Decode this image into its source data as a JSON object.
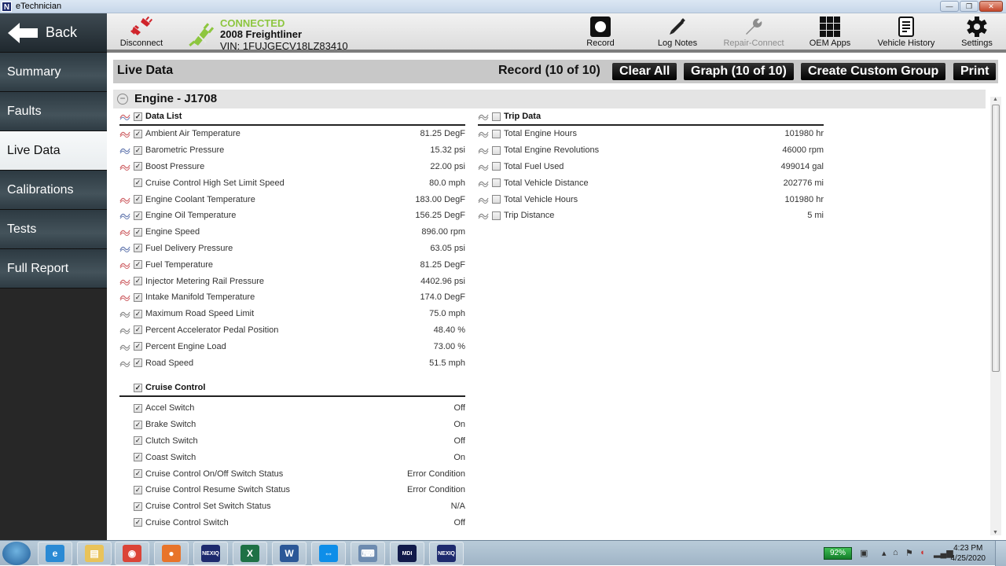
{
  "window": {
    "title": "eTechnician",
    "app_icon": "N",
    "controls": {
      "minimize": "—",
      "restore": "❐",
      "close": "✕"
    }
  },
  "toolbar": {
    "back_label": "Back",
    "disconnect_label": "Disconnect",
    "connection_status": "CONNECTED",
    "vehicle": "2008 Freightliner",
    "vin": "VIN: 1FUJGECV18LZ83410",
    "record_label": "Record",
    "log_notes_label": "Log Notes",
    "repair_connect_label": "Repair-Connect",
    "oem_apps_label": "OEM Apps",
    "vehicle_history_label": "Vehicle History",
    "settings_label": "Settings"
  },
  "sidebar": {
    "items": [
      {
        "label": "Summary",
        "active": false
      },
      {
        "label": "Faults",
        "active": false
      },
      {
        "label": "Live Data",
        "active": true
      },
      {
        "label": "Calibrations",
        "active": false
      },
      {
        "label": "Tests",
        "active": false
      },
      {
        "label": "Full Report",
        "active": false
      }
    ]
  },
  "live_data": {
    "title": "Live Data",
    "record_status": "Record (10 of 10)",
    "clear_all_label": "Clear All",
    "graph_label": "Graph (10 of 10)",
    "create_group_label": "Create Custom Group",
    "print_label": "Print",
    "section_name": "Engine - J1708",
    "collapse_glyph": "−",
    "data_list": {
      "title": "Data List",
      "checked": true,
      "rows": [
        {
          "label": "Ambient Air Temperature",
          "value": "81.25 DegF",
          "graph": "red",
          "checked": true
        },
        {
          "label": "Barometric Pressure",
          "value": "15.32 psi",
          "graph": "blue",
          "checked": true
        },
        {
          "label": "Boost Pressure",
          "value": "22.00 psi",
          "graph": "red",
          "checked": true
        },
        {
          "label": "Cruise Control High Set Limit Speed",
          "value": "80.0 mph",
          "graph": "",
          "checked": true
        },
        {
          "label": "Engine Coolant Temperature",
          "value": "183.00 DegF",
          "graph": "red",
          "checked": true
        },
        {
          "label": "Engine Oil Temperature",
          "value": "156.25 DegF",
          "graph": "blue",
          "checked": true
        },
        {
          "label": "Engine Speed",
          "value": "896.00 rpm",
          "graph": "red",
          "checked": true
        },
        {
          "label": "Fuel Delivery Pressure",
          "value": "63.05 psi",
          "graph": "blue",
          "checked": true
        },
        {
          "label": "Fuel Temperature",
          "value": "81.25 DegF",
          "graph": "red",
          "checked": true
        },
        {
          "label": "Injector Metering Rail Pressure",
          "value": "4402.96 psi",
          "graph": "red",
          "checked": true
        },
        {
          "label": "Intake Manifold Temperature",
          "value": "174.0 DegF",
          "graph": "red",
          "checked": true
        },
        {
          "label": "Maximum Road Speed Limit",
          "value": "75.0 mph",
          "graph": "gray",
          "checked": true
        },
        {
          "label": "Percent Accelerator Pedal Position",
          "value": "48.40 %",
          "graph": "gray",
          "checked": true
        },
        {
          "label": "Percent Engine Load",
          "value": "73.00 %",
          "graph": "gray",
          "checked": true
        },
        {
          "label": "Road Speed",
          "value": "51.5 mph",
          "graph": "gray",
          "checked": true
        }
      ]
    },
    "cruise_control": {
      "title": "Cruise Control",
      "checked": true,
      "rows": [
        {
          "label": "Accel Switch",
          "value": "Off",
          "checked": true
        },
        {
          "label": "Brake Switch",
          "value": "On",
          "checked": true
        },
        {
          "label": "Clutch Switch",
          "value": "Off",
          "checked": true
        },
        {
          "label": "Coast Switch",
          "value": "On",
          "checked": true
        },
        {
          "label": "Cruise Control On/Off Switch Status",
          "value": "Error Condition",
          "checked": true
        },
        {
          "label": "Cruise Control Resume Switch Status",
          "value": "Error Condition",
          "checked": true
        },
        {
          "label": "Cruise Control Set Switch Status",
          "value": "N/A",
          "checked": true
        },
        {
          "label": "Cruise Control Switch",
          "value": "Off",
          "checked": true
        }
      ]
    },
    "trip_data": {
      "title": "Trip Data",
      "checked": false,
      "rows": [
        {
          "label": "Total Engine Hours",
          "value": "101980 hr",
          "graph": "gray",
          "checked": false
        },
        {
          "label": "Total Engine Revolutions",
          "value": "46000 rpm",
          "graph": "gray",
          "checked": false
        },
        {
          "label": "Total Fuel Used",
          "value": "499014 gal",
          "graph": "gray",
          "checked": false
        },
        {
          "label": "Total Vehicle Distance",
          "value": "202776 mi",
          "graph": "gray",
          "checked": false
        },
        {
          "label": "Total Vehicle Hours",
          "value": "101980 hr",
          "graph": "gray",
          "checked": false
        },
        {
          "label": "Trip Distance",
          "value": "5 mi",
          "graph": "gray",
          "checked": false
        }
      ]
    }
  },
  "taskbar": {
    "apps": [
      {
        "name": "internet-explorer",
        "glyph": "e",
        "color": "#2a8ad4"
      },
      {
        "name": "file-explorer",
        "glyph": "▤",
        "color": "#e9c35a"
      },
      {
        "name": "chrome",
        "glyph": "◉",
        "color": "#db4437"
      },
      {
        "name": "firefox",
        "glyph": "●",
        "color": "#e8742a"
      },
      {
        "name": "nexiq",
        "glyph": "NEXIQ",
        "color": "#1d2a6e"
      },
      {
        "name": "excel",
        "glyph": "X",
        "color": "#1e7145"
      },
      {
        "name": "word",
        "glyph": "W",
        "color": "#2b5797"
      },
      {
        "name": "teamviewer",
        "glyph": "⇔",
        "color": "#0e8ee9"
      },
      {
        "name": "device-manager",
        "glyph": "⌨",
        "color": "#6d8bb0"
      },
      {
        "name": "mdi",
        "glyph": "MDI",
        "color": "#111a4a"
      },
      {
        "name": "nexiq-etechnician",
        "glyph": "NEXIQ",
        "color": "#1d2a6e"
      }
    ],
    "battery": "92%",
    "time": "4:23 PM",
    "date": "4/25/2020"
  },
  "colors": {
    "connected": "#8dc63f",
    "disconnect": "#d0242b",
    "graph_red": "#d0676b",
    "graph_blue": "#6b7fb3",
    "graph_gray": "#8a8a8a"
  }
}
